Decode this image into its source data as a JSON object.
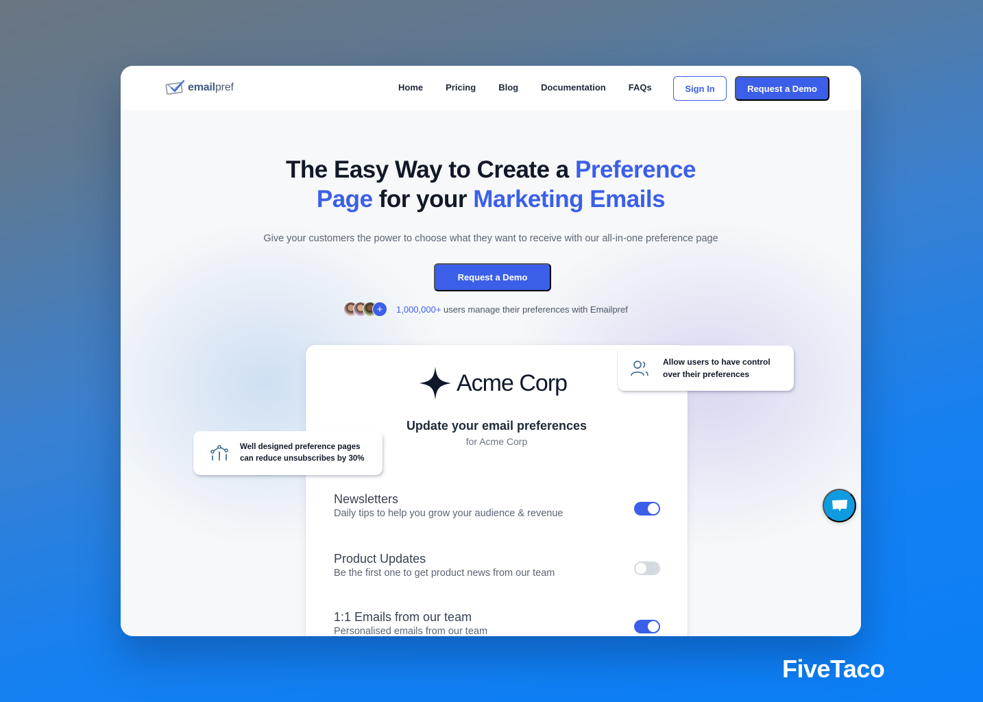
{
  "nav": {
    "logo_bold": "email",
    "logo_light": "pref",
    "links": [
      "Home",
      "Pricing",
      "Blog",
      "Documentation",
      "FAQs"
    ],
    "sign_in": "Sign In",
    "request_demo": "Request a Demo"
  },
  "hero": {
    "title_part1": "The Easy Way to Create a ",
    "title_hl1": "Preference",
    "title_hl2": "Page",
    "title_part2": " for your ",
    "title_hl3": "Marketing Emails",
    "subtitle": "Give your customers the power to choose what they want to receive with our all-in-one preference page",
    "cta": "Request a Demo",
    "social_count": "1,000,000+",
    "social_text": " users manage their preferences with Emailpref",
    "plus_icon": "+"
  },
  "preview": {
    "company": "Acme Corp",
    "title": "Update your email preferences",
    "subtitle": "for Acme Corp",
    "preferences": [
      {
        "name": "Newsletters",
        "description": "Daily tips to help you grow your audience & revenue",
        "enabled": true
      },
      {
        "name": "Product Updates",
        "description": "Be the first one to get product news from our team",
        "enabled": false
      },
      {
        "name": "1:1 Emails from our team",
        "description": "Personalised emails from our team",
        "enabled": true
      }
    ]
  },
  "callouts": {
    "control": "Allow users to have control over their preferences",
    "control_line1": "Allow users to have control",
    "control_line2": "over their preferences",
    "stats_line1": "Well designed preference pages",
    "stats_line2": "can reduce unsubscribes by 30%"
  },
  "watermark": "FiveTaco",
  "colors": {
    "accent": "#3b5fe8",
    "chat": "#0f9be0",
    "toggle_off": "#d5d9e0"
  }
}
